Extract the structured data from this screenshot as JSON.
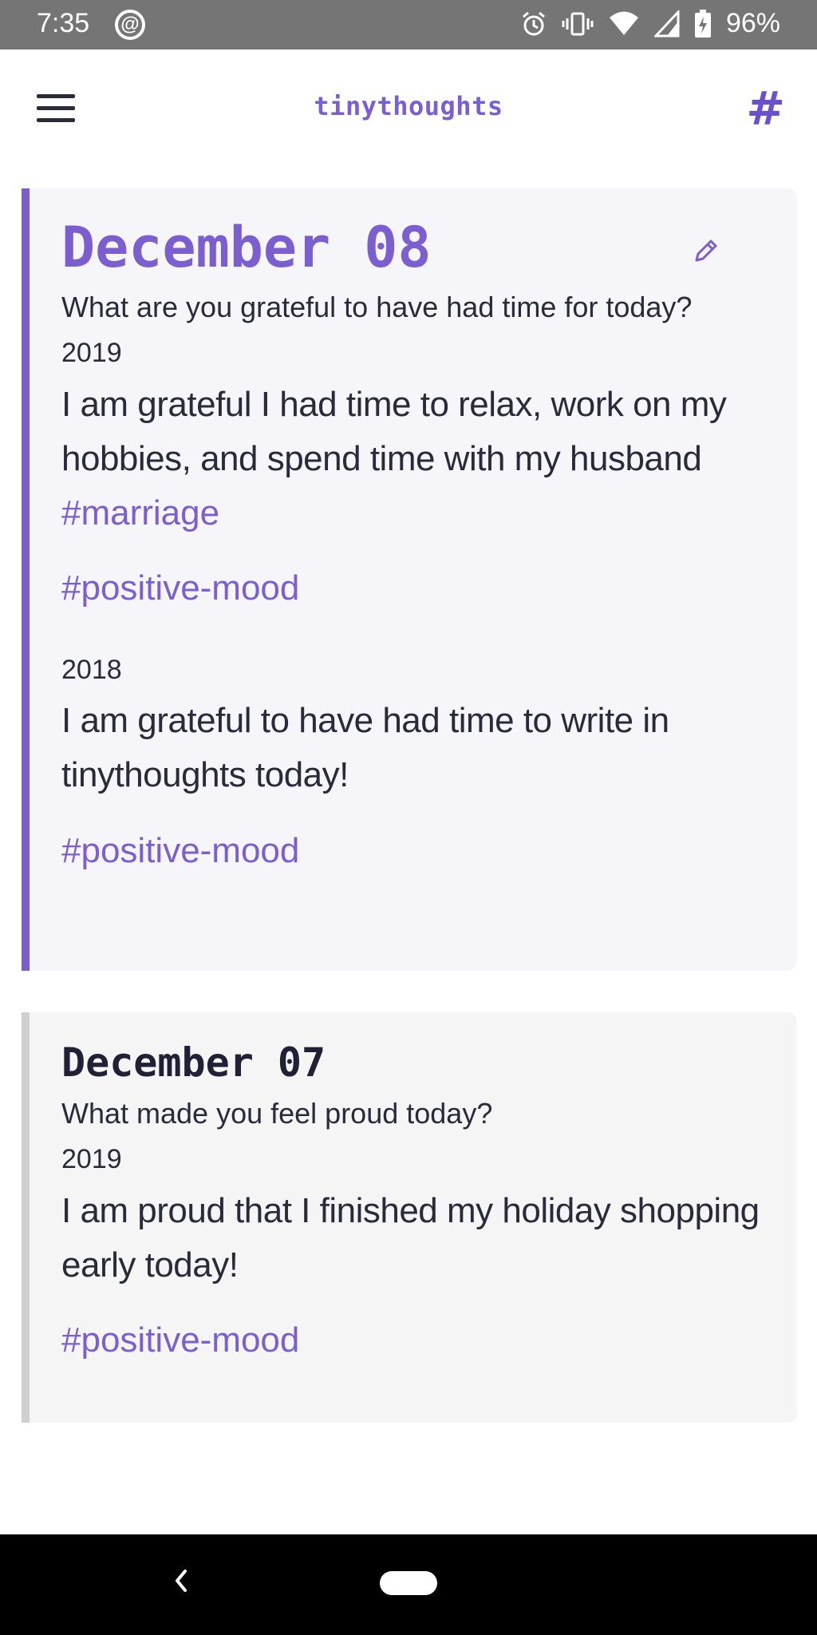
{
  "status_bar": {
    "time": "7:35",
    "battery_percent": "96%",
    "icons": [
      "at-sign-icon",
      "alarm-icon",
      "vibrate-icon",
      "wifi-icon",
      "signal-icon",
      "battery-charging-icon"
    ]
  },
  "app_bar": {
    "title": "tinythoughts",
    "hash_label": "#"
  },
  "colors": {
    "accent": "#7b5fd0",
    "card_active_bg": "#f6f5fa",
    "card_inactive_bg": "#f5f5f5",
    "inactive_bar": "#d0d0d0"
  },
  "cards": [
    {
      "date": "December 08",
      "prompt": "What are you grateful to have had time for today?",
      "entries": [
        {
          "year": "2019",
          "text": "I am grateful I had time to relax, work on my hobbies, and spend time with my husband",
          "hashtags": [
            "#marriage",
            "#positive-mood"
          ]
        },
        {
          "year": "2018",
          "text": "I am grateful to have had time to write in tinythoughts today!",
          "hashtags": [
            "#positive-mood"
          ]
        }
      ]
    },
    {
      "date": "December 07",
      "prompt": "What made you feel proud today?",
      "entries": [
        {
          "year": "2019",
          "text": "I am proud that I finished my holiday shopping early today!",
          "hashtags": [
            "#positive-mood"
          ]
        }
      ]
    }
  ]
}
